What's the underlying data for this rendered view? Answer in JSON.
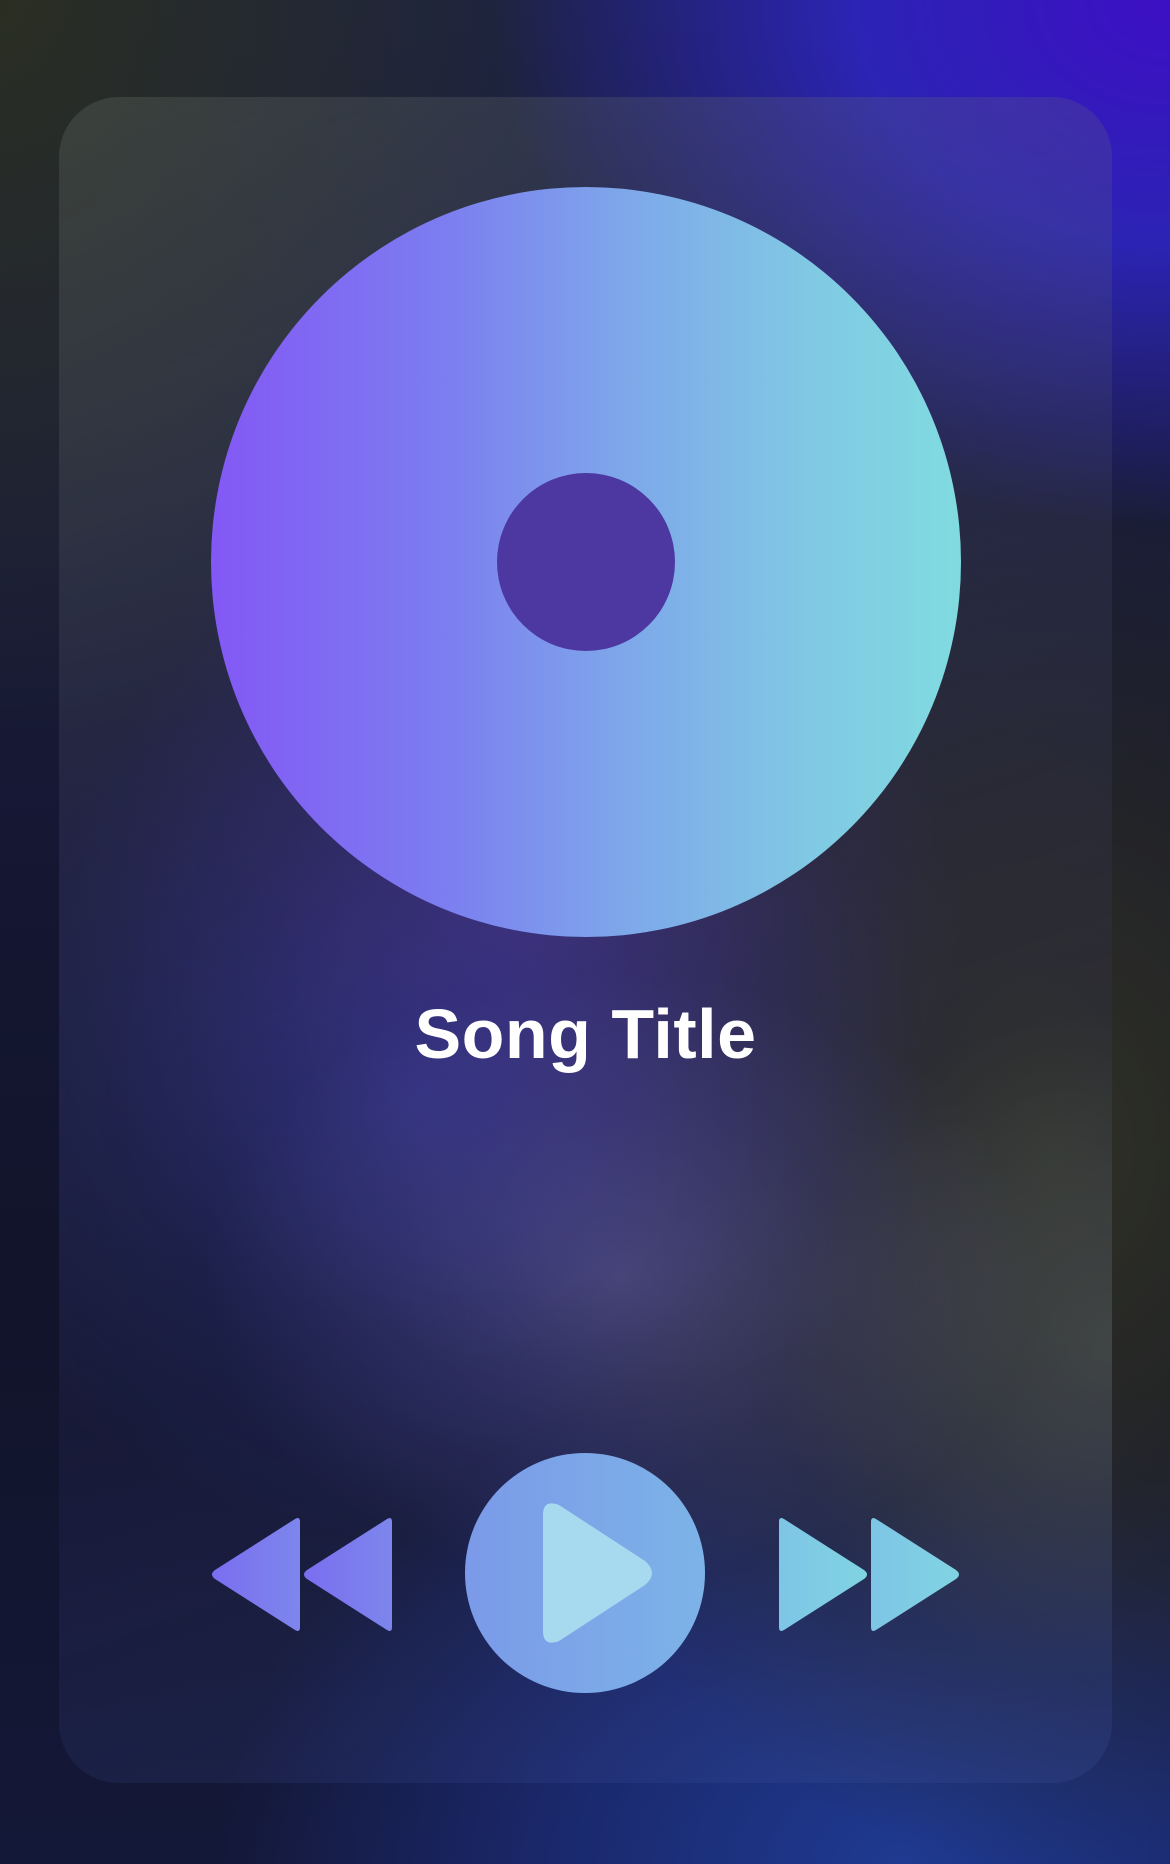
{
  "player": {
    "song_title": "Song Title",
    "album_art": {
      "shape": "disc",
      "gradient_colors": [
        "#8358f5",
        "#7ea7ea",
        "#80dbe0"
      ],
      "center_color": "#4d37a0"
    },
    "controls": {
      "previous": {
        "icon": "rewind-icon"
      },
      "play": {
        "icon": "play-icon",
        "state": "paused"
      },
      "next": {
        "icon": "fast-forward-icon"
      }
    }
  }
}
